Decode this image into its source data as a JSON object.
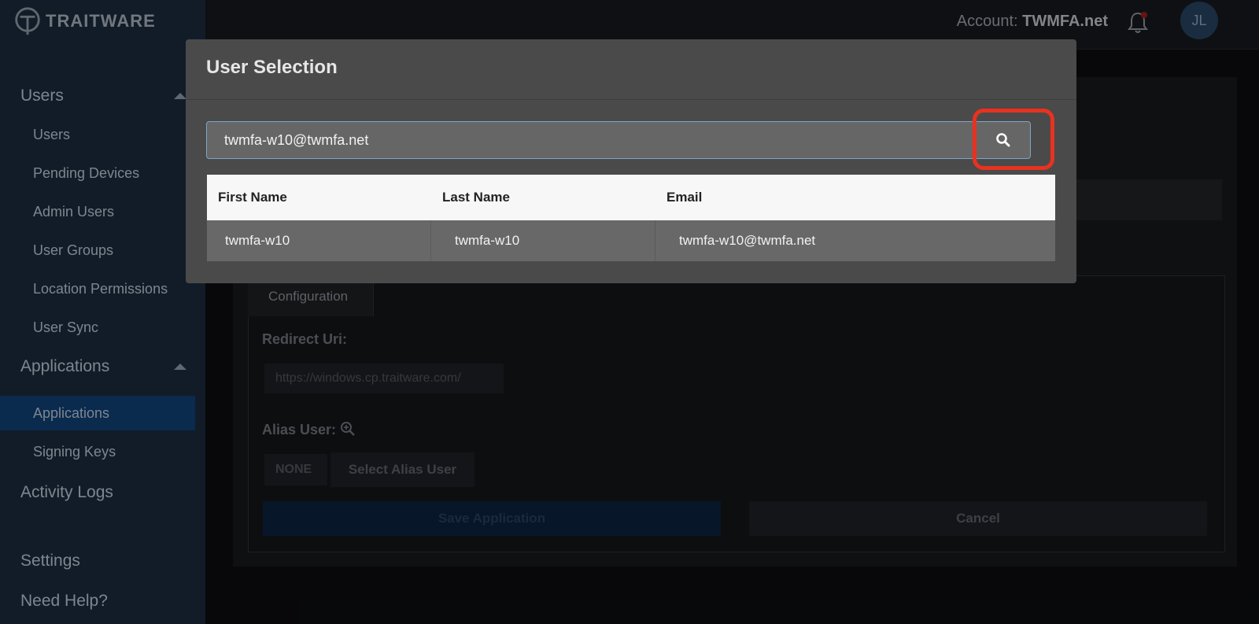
{
  "brand": {
    "logo_text": "TRAITWARE"
  },
  "header": {
    "account_label": "Account:",
    "account_name": "TWMFA.net",
    "avatar_initials": "JL"
  },
  "sidebar": {
    "sections": [
      {
        "label": "Users",
        "items": [
          "Users",
          "Pending Devices",
          "Admin Users",
          "User Groups",
          "Location Permissions",
          "User Sync"
        ]
      },
      {
        "label": "Applications",
        "items": [
          "Applications",
          "Signing Keys"
        ]
      }
    ],
    "bottom": [
      "Activity Logs",
      "Settings",
      "Need Help?"
    ],
    "active_item": "Applications"
  },
  "background": {
    "tab_label": "Configuration",
    "redirect_label": "Redirect Uri:",
    "redirect_value": "https://windows.cp.traitware.com/",
    "alias_label": "Alias User:",
    "alias_value": "NONE",
    "select_alias_label": "Select Alias User",
    "save_label": "Save Application",
    "cancel_label": "Cancel"
  },
  "modal": {
    "title": "User Selection",
    "search_value": "twmfa-w10@twmfa.net",
    "columns": [
      "First Name",
      "Last Name",
      "Email"
    ],
    "rows": [
      {
        "first": "twmfa-w10",
        "last": "twmfa-w10",
        "email": "twmfa-w10@twmfa.net"
      }
    ]
  },
  "colors": {
    "highlight": "#e8321f",
    "sidebar_bg": "#1a2a3c",
    "active_bg": "#0f3f74"
  }
}
